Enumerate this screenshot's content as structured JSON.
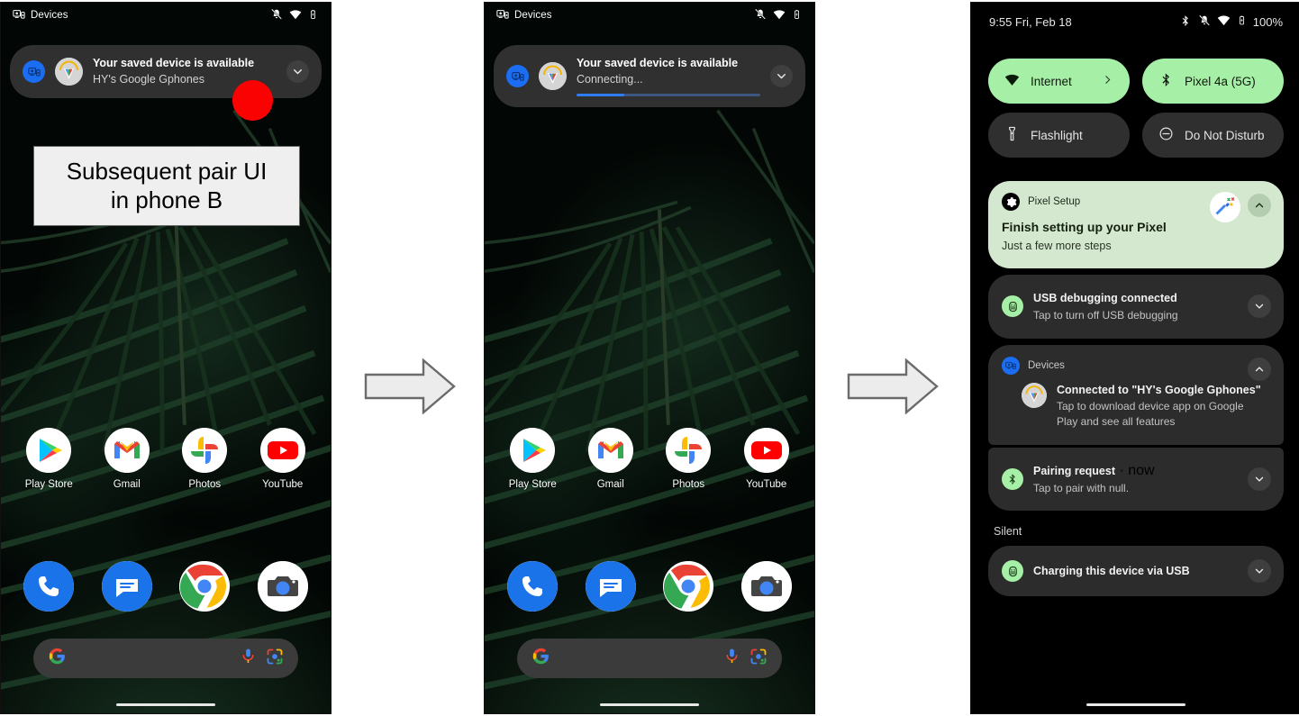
{
  "diagram": {
    "callout_text_line1": "Subsequent pair UI",
    "callout_text_line2": "in phone B",
    "arrow_label": "flow-arrow"
  },
  "phone_a": {
    "statusbar": {
      "app_label": "Devices",
      "icons": [
        "devices-icon",
        "vibrate-off-icon",
        "wifi-icon",
        "battery-charging-icon"
      ]
    },
    "notification": {
      "title": "Your saved device is available",
      "subtitle": "HY's Google Gphones",
      "app_icon": "devices-icon",
      "avatar": "pixel-buds-avatar",
      "expand_icon": "chevron-down-icon"
    },
    "apps": [
      {
        "label": "Play Store",
        "icon": "play-store-icon"
      },
      {
        "label": "Gmail",
        "icon": "gmail-icon"
      },
      {
        "label": "Photos",
        "icon": "google-photos-icon"
      },
      {
        "label": "YouTube",
        "icon": "youtube-icon"
      }
    ],
    "dock": [
      {
        "label": "Phone",
        "icon": "phone-icon"
      },
      {
        "label": "Messages",
        "icon": "messages-icon"
      },
      {
        "label": "Chrome",
        "icon": "chrome-icon"
      },
      {
        "label": "Camera",
        "icon": "camera-icon"
      }
    ],
    "search": {
      "placeholder": "",
      "google_icon": "google-g-icon",
      "mic_icon": "microphone-icon",
      "lens_icon": "google-lens-icon"
    }
  },
  "phone_b": {
    "statusbar": {
      "app_label": "Devices",
      "icons": [
        "devices-icon",
        "vibrate-off-icon",
        "wifi-icon",
        "battery-charging-icon"
      ]
    },
    "notification": {
      "title": "Your saved device is available",
      "subtitle": "Connecting...",
      "app_icon": "devices-icon",
      "avatar": "pixel-buds-avatar",
      "expand_icon": "chevron-down-icon",
      "progress_percent": 26
    },
    "apps": [
      {
        "label": "Play Store",
        "icon": "play-store-icon"
      },
      {
        "label": "Gmail",
        "icon": "gmail-icon"
      },
      {
        "label": "Photos",
        "icon": "google-photos-icon"
      },
      {
        "label": "YouTube",
        "icon": "youtube-icon"
      }
    ],
    "dock": [
      {
        "label": "Phone",
        "icon": "phone-icon"
      },
      {
        "label": "Messages",
        "icon": "messages-icon"
      },
      {
        "label": "Chrome",
        "icon": "chrome-icon"
      },
      {
        "label": "Camera",
        "icon": "camera-icon"
      }
    ]
  },
  "phone_c": {
    "statusbar": {
      "clock": "9:55 Fri, Feb 18",
      "battery_percent": "100%",
      "icons": [
        "bluetooth-icon",
        "vibrate-off-icon",
        "wifi-icon",
        "battery-charging-icon"
      ]
    },
    "quick_settings": [
      {
        "label": "Internet",
        "icon": "wifi-icon",
        "state": "on",
        "has_chevron": true
      },
      {
        "label": "Pixel 4a (5G)",
        "icon": "bluetooth-icon",
        "state": "on",
        "has_chevron": false
      },
      {
        "label": "Flashlight",
        "icon": "flashlight-icon",
        "state": "off",
        "has_chevron": false
      },
      {
        "label": "Do Not Disturb",
        "icon": "do-not-disturb-icon",
        "state": "off",
        "has_chevron": false
      }
    ],
    "notifications": [
      {
        "id": "pixel-setup",
        "app_name": "Pixel Setup",
        "title": "Finish setting up your Pixel",
        "subtitle": "Just a few more steps",
        "app_icon": "settings-gear-icon",
        "art_icon": "magic-wand-icon",
        "expand_icon": "chevron-up-icon",
        "highlight": true
      },
      {
        "id": "usb-debugging",
        "title": "USB debugging connected",
        "subtitle": "Tap to turn off USB debugging",
        "app_icon": "android-usb-icon",
        "expand_icon": "chevron-down-icon",
        "highlight": false
      },
      {
        "id": "devices",
        "app_name": "Devices",
        "title": "Connected to \"HY's Google Gphones\"",
        "subtitle": "Tap to download device app on Google Play and see all features",
        "app_icon": "devices-icon",
        "avatar": "pixel-buds-avatar",
        "expand_icon": "chevron-up-icon",
        "highlight": false
      },
      {
        "id": "pairing-request",
        "title": "Pairing request",
        "time": "now",
        "subtitle": "Tap to pair with null.",
        "app_icon": "bluetooth-icon",
        "expand_icon": "chevron-down-icon",
        "highlight": false
      }
    ],
    "silent_section_label": "Silent",
    "silent_notifications": [
      {
        "id": "charging",
        "title": "Charging this device via USB",
        "app_icon": "android-usb-icon",
        "expand_icon": "chevron-down-icon"
      }
    ]
  },
  "colors": {
    "accent_green": "#a6efa6",
    "notif_highlight": "#d3e8cf",
    "annotation_red": "#fa0202",
    "notif_bg": "#2b2c2b",
    "heads_up_bg": "#303030",
    "progress_blue": "#2f7df5"
  }
}
